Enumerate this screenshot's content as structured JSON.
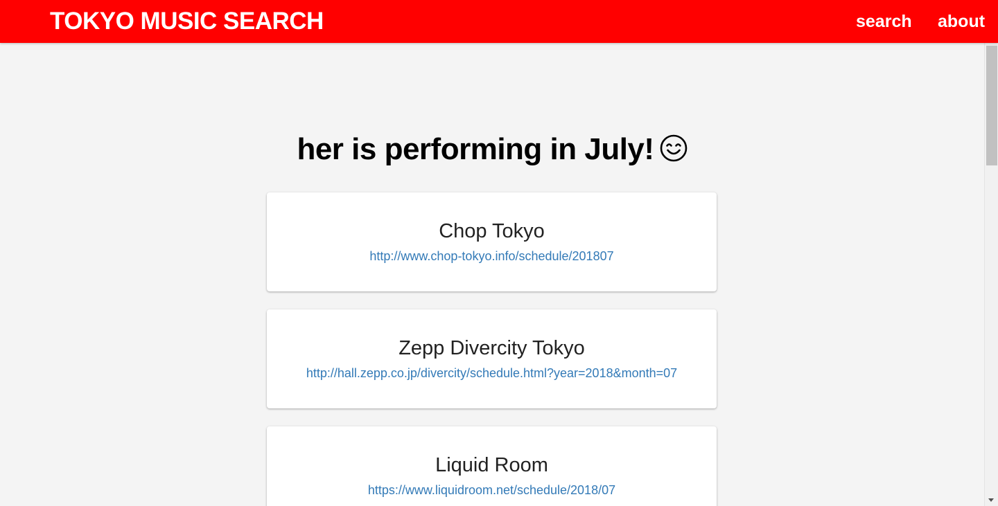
{
  "navbar": {
    "brand": "TOKYO MUSIC SEARCH",
    "links": [
      {
        "label": "search"
      },
      {
        "label": "about"
      }
    ],
    "background_color": "#ff0000"
  },
  "main": {
    "headline": "her is performing in July!",
    "headline_emoji": "smiling-face-icon",
    "venues": [
      {
        "name": "Chop Tokyo",
        "url": "http://www.chop-tokyo.info/schedule/201807"
      },
      {
        "name": "Zepp Divercity Tokyo",
        "url": "http://hall.zepp.co.jp/divercity/schedule.html?year=2018&month=07"
      },
      {
        "name": "Liquid Room",
        "url": "https://www.liquidroom.net/schedule/2018/07"
      }
    ],
    "link_color": "#337ab7"
  }
}
